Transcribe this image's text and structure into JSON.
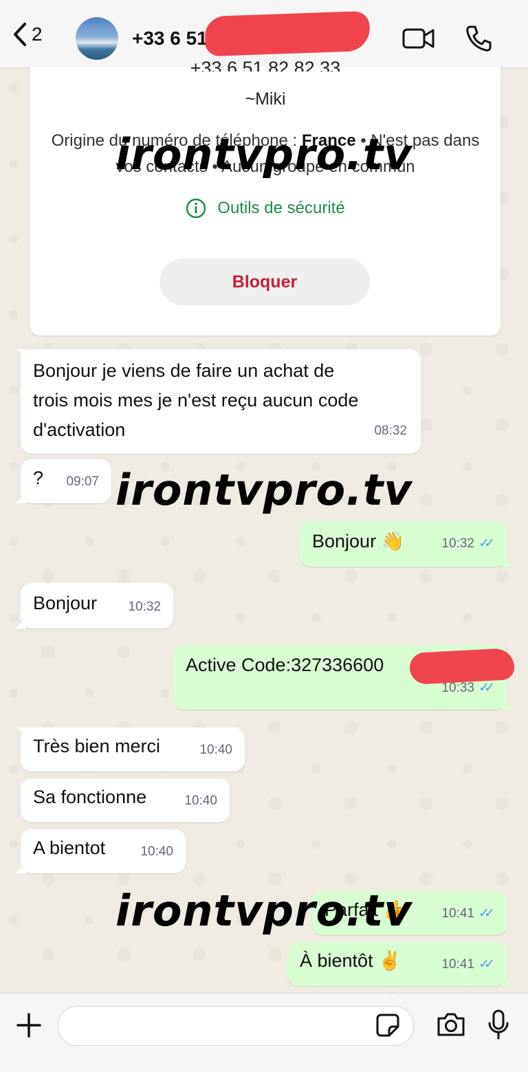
{
  "header": {
    "back_count": "2",
    "contact_name": "+33 6 51",
    "icons": [
      "chevron-left-icon",
      "video-camera-icon",
      "phone-icon"
    ]
  },
  "info_card": {
    "number_partial": "+33 6 51 82 82 33",
    "name": "~Miki",
    "origin_label": "Origine du numéro de téléphone : ",
    "origin_country": "France",
    "origin_rest": " • N'est pas dans vos contacts • Aucun groupe en commun",
    "safety_tools": "Outils de sécurité",
    "block_button": "Bloquer"
  },
  "messages": [
    {
      "dir": "in",
      "lines": [
        "Bonjour je viens de faire un achat de",
        "trois mois mes je n'est reçu aucun code",
        "d'activation"
      ],
      "time": "08:32"
    },
    {
      "dir": "in",
      "text": "?",
      "time": "09:07"
    },
    {
      "dir": "out",
      "text": "Bonjour 👋",
      "time": "10:32"
    },
    {
      "dir": "in",
      "text": "Bonjour",
      "time": "10:32"
    },
    {
      "dir": "out",
      "text": "Active Code:327336600",
      "time": "10:33"
    },
    {
      "dir": "in",
      "text": "Très bien merci",
      "time": "10:40"
    },
    {
      "dir": "in",
      "text": "Sa fonctionne",
      "time": "10:40"
    },
    {
      "dir": "in",
      "text": "A bientot",
      "time": "10:40"
    },
    {
      "dir": "out",
      "text": "Parfait 👍",
      "time": "10:41"
    },
    {
      "dir": "out",
      "text": "À bientôt ✌️",
      "time": "10:41"
    }
  ],
  "read_ticks": "✓✓",
  "watermark": "irontvpro.tv",
  "input_bar": {
    "icons": [
      "plus-icon",
      "sticker-icon",
      "camera-icon",
      "microphone-icon"
    ]
  },
  "colors": {
    "outgoing_bubble": "#d9fdd3",
    "incoming_bubble": "#ffffff",
    "chat_background": "#efeae2",
    "block_text": "#c21f3a",
    "safety_green": "#1f8b4d",
    "read_tick_blue": "#4aa0e8"
  }
}
